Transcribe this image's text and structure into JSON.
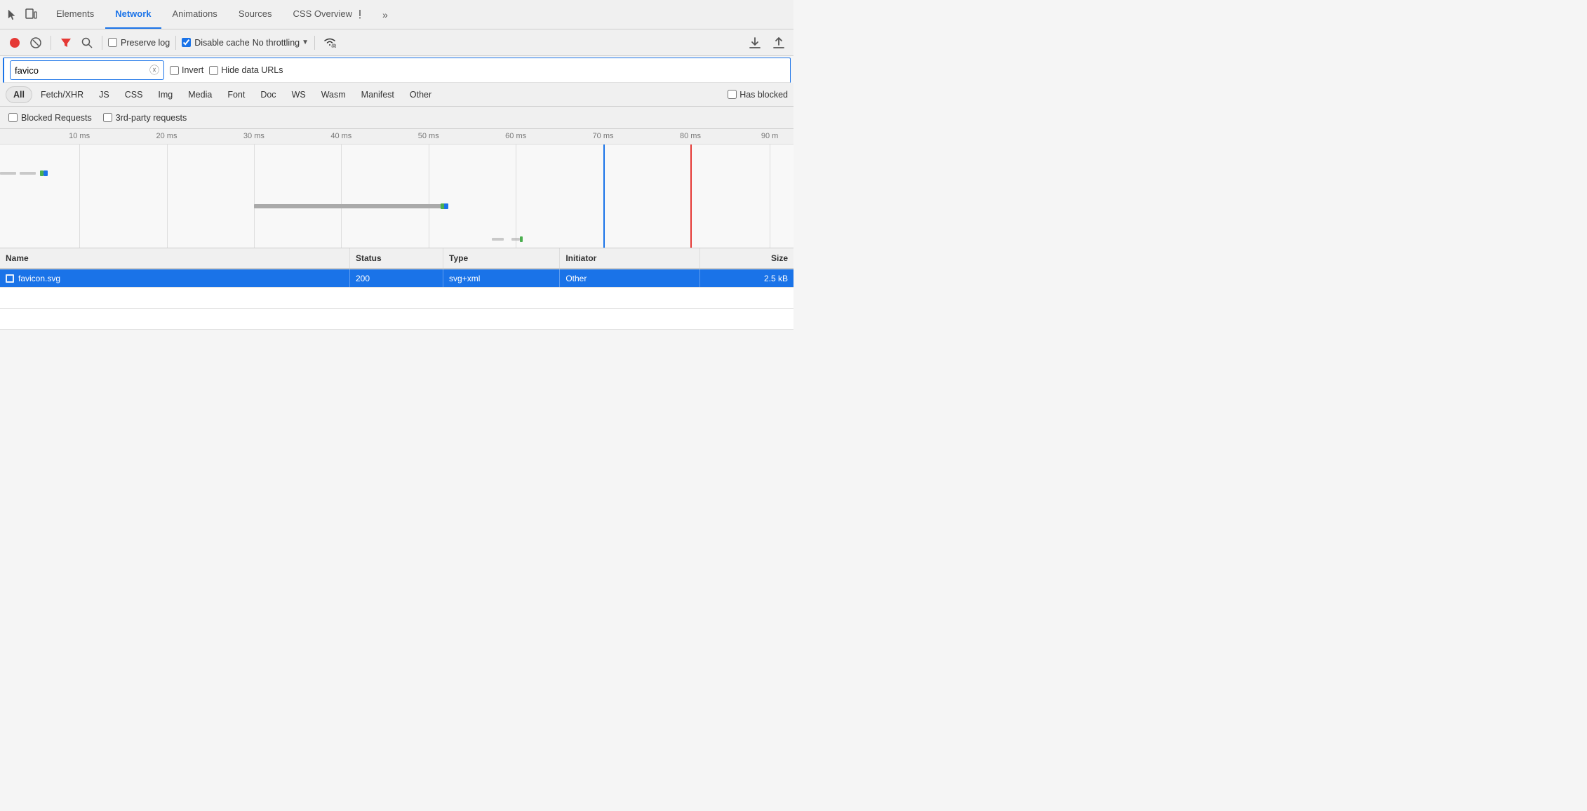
{
  "tabs": {
    "items": [
      {
        "id": "elements",
        "label": "Elements",
        "active": false
      },
      {
        "id": "network",
        "label": "Network",
        "active": true
      },
      {
        "id": "animations",
        "label": "Animations",
        "active": false
      },
      {
        "id": "sources",
        "label": "Sources",
        "active": false
      },
      {
        "id": "css-overview",
        "label": "CSS Overview",
        "active": false
      }
    ],
    "more_label": "»"
  },
  "toolbar": {
    "record_title": "Record",
    "clear_title": "Clear",
    "filter_title": "Filter",
    "search_title": "Search",
    "preserve_log_label": "Preserve log",
    "disable_cache_label": "Disable cache",
    "throttle_label": "No throttling",
    "upload_title": "Upload",
    "download_title": "Download"
  },
  "filter": {
    "placeholder": "favico",
    "invert_label": "Invert",
    "hide_data_urls_label": "Hide data URLs"
  },
  "type_filters": {
    "items": [
      {
        "id": "all",
        "label": "All",
        "active": true
      },
      {
        "id": "fetch-xhr",
        "label": "Fetch/XHR",
        "active": false
      },
      {
        "id": "js",
        "label": "JS",
        "active": false
      },
      {
        "id": "css",
        "label": "CSS",
        "active": false
      },
      {
        "id": "img",
        "label": "Img",
        "active": false
      },
      {
        "id": "media",
        "label": "Media",
        "active": false
      },
      {
        "id": "font",
        "label": "Font",
        "active": false
      },
      {
        "id": "doc",
        "label": "Doc",
        "active": false
      },
      {
        "id": "ws",
        "label": "WS",
        "active": false
      },
      {
        "id": "wasm",
        "label": "Wasm",
        "active": false
      },
      {
        "id": "manifest",
        "label": "Manifest",
        "active": false
      },
      {
        "id": "other",
        "label": "Other",
        "active": false
      }
    ],
    "has_blocked_label": "Has blocked"
  },
  "blocked_row": {
    "blocked_requests_label": "Blocked Requests",
    "third_party_label": "3rd-party requests"
  },
  "waterfall": {
    "ruler_marks": [
      "10 ms",
      "20 ms",
      "30 ms",
      "40 ms",
      "50 ms",
      "60 ms",
      "70 ms",
      "80 ms",
      "90 m"
    ]
  },
  "table": {
    "columns": [
      "Name",
      "Status",
      "Type",
      "Initiator",
      "Size"
    ],
    "rows": [
      {
        "name": "favicon.svg",
        "status": "200",
        "type": "svg+xml",
        "initiator": "Other",
        "size": "2.5 kB",
        "selected": true
      }
    ]
  }
}
